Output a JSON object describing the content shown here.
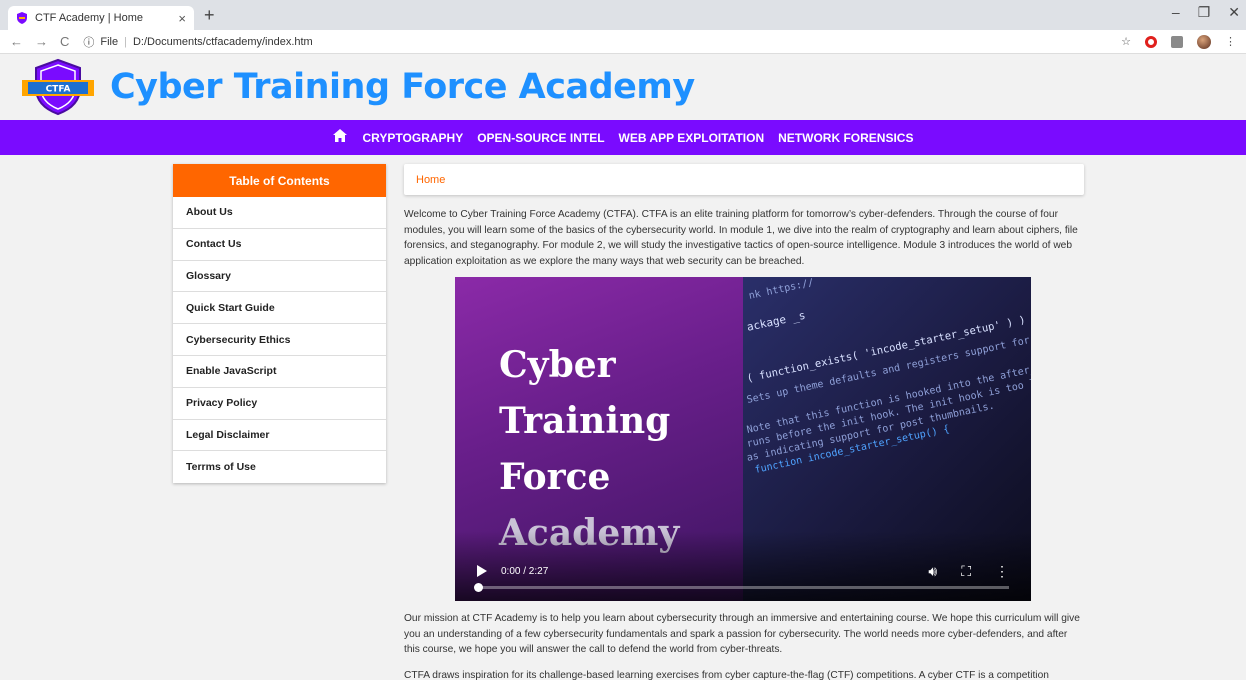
{
  "browser": {
    "tab_title": "CTF Academy | Home",
    "tab_close": "×",
    "new_tab": "+",
    "url_scheme": "File",
    "url": "D:/Documents/ctfacademy/index.htm"
  },
  "header": {
    "logo_text": "CTFA",
    "title": "Cyber Training Force Academy"
  },
  "nav": {
    "items": [
      "CRYPTOGRAPHY",
      "OPEN-SOURCE INTEL",
      "WEB APP EXPLOITATION",
      "NETWORK FORENSICS"
    ]
  },
  "toc": {
    "heading": "Table of Contents",
    "items": [
      "About Us",
      "Contact Us",
      "Glossary",
      "Quick Start Guide",
      "Cybersecurity Ethics",
      "Enable JavaScript",
      "Privacy Policy",
      "Legal Disclaimer",
      "Terrms of Use"
    ]
  },
  "main": {
    "breadcrumb": "Home",
    "intro": "Welcome to Cyber Training Force Academy (CTFA). CTFA is an elite training platform for tomorrow’s cyber-defenders. Through the course of four modules, you will learn some of the basics of the cybersecurity world. In module 1, we dive into the realm of cryptography and learn about ciphers, file forensics, and steganography. For module 2, we will study the investigative tactics of open-source intelligence. Module 3 introduces the world of web application exploitation as we explore the many ways that web security can be breached.",
    "mission": "Our mission at CTF Academy is to help you learn about cybersecurity through an immersive and entertaining course. We hope this curriculum will give you an understanding of a few cybersecurity fundamentals and spark a passion for cybersecurity. The world needs more cyber-defenders, and after this course, we hope you will answer the call to defend the world from cyber-threats.",
    "ctf_partial": "CTFA draws inspiration for its challenge-based learning exercises from cyber capture-the-flag (CTF) competitions. A cyber CTF is a competition"
  },
  "video": {
    "title_lines": [
      "Cyber",
      "Training",
      "Force",
      "Academy"
    ],
    "code_lines": [
      "nk https://",
      "ackage _s",
      "( function_exists( 'incode_starter_setup' ) )",
      "Sets up theme defaults and registers support for va",
      "Note that this function is hooked into the after_se",
      "runs before the init hook. The init hook is too late",
      "as indicating support for post thumbnails.",
      "function incode_starter_setup() {"
    ],
    "time": "0:00 / 2:27",
    "progress": 0
  }
}
